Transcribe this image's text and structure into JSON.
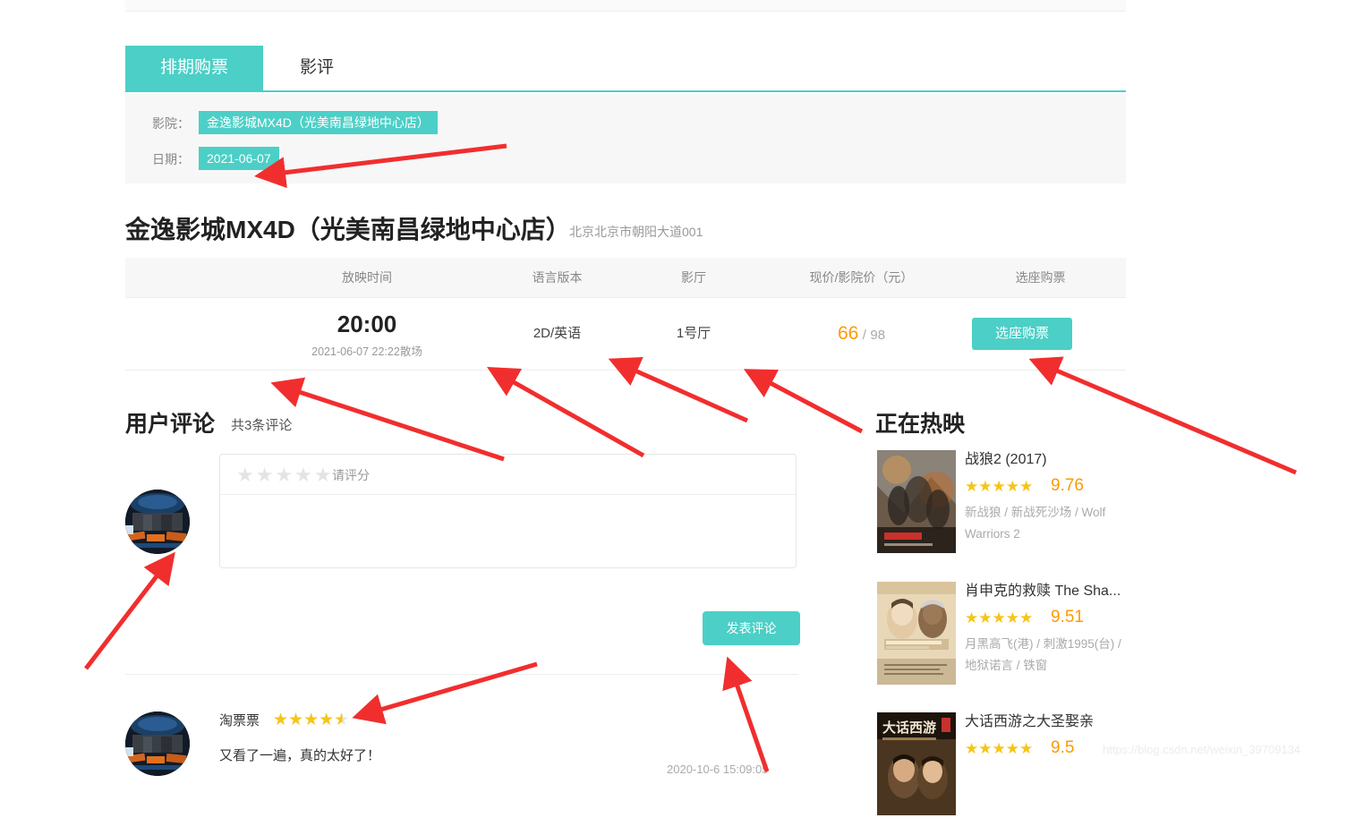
{
  "tabs": [
    {
      "label": "排期购票",
      "active": true
    },
    {
      "label": "影评",
      "active": false
    }
  ],
  "filters": {
    "cinema_label": "影院：",
    "cinema_value": "金逸影城MX4D（光美南昌绿地中心店）",
    "date_label": "日期：",
    "date_value": "2021-06-07"
  },
  "cinema": {
    "name": "金逸影城MX4D（光美南昌绿地中心店）",
    "address": "北京北京市朝阳大道001"
  },
  "schedule": {
    "headers": [
      "放映时间",
      "语言版本",
      "影厅",
      "现价/影院价（元）",
      "选座购票"
    ],
    "rows": [
      {
        "time": "20:00",
        "time_sub": "2021-06-07 22:22散场",
        "language": "2D/英语",
        "hall": "1号厅",
        "price_now": "66",
        "price_sep": "/",
        "price_old": "98",
        "buy_label": "选座购票"
      }
    ]
  },
  "comments": {
    "title": "用户评论",
    "count_text": "共3条评论",
    "editor": {
      "stars_empty": "★★★★★",
      "rate_placeholder": "请评分",
      "text_value": "",
      "post_label": "发表评论"
    },
    "list": [
      {
        "user": "淘票票",
        "stars": "★★★★",
        "half_star": "★",
        "text": "又看了一遍，真的太好了！",
        "time": "2020-10-6 15:09:05"
      }
    ]
  },
  "hot": {
    "title": "正在热映",
    "movies": [
      {
        "name": "战狼2 (2017)",
        "stars": "★★★★★",
        "score": "9.76",
        "alias": "新战狼 / 新战死沙场 / Wolf Warriors 2",
        "poster": "wolf-warriors-2"
      },
      {
        "name": "肖申克的救赎 The Sha...",
        "stars": "★★★★★",
        "score": "9.51",
        "alias": "月黑高飞(港) / 刺激1995(台) / 地狱诺言 / 铁窗",
        "poster": "shawshank-redemption"
      },
      {
        "name": "大话西游之大圣娶亲",
        "stars": "★★★★★",
        "score": "9.5",
        "alias": "",
        "poster": "chinese-odyssey"
      }
    ]
  },
  "watermark": "https://blog.csdn.net/weixin_39709134",
  "colors": {
    "accent": "#4ccfc6",
    "price": "#ff9900",
    "star": "#f5c518",
    "annotation": "#f12e2e"
  }
}
